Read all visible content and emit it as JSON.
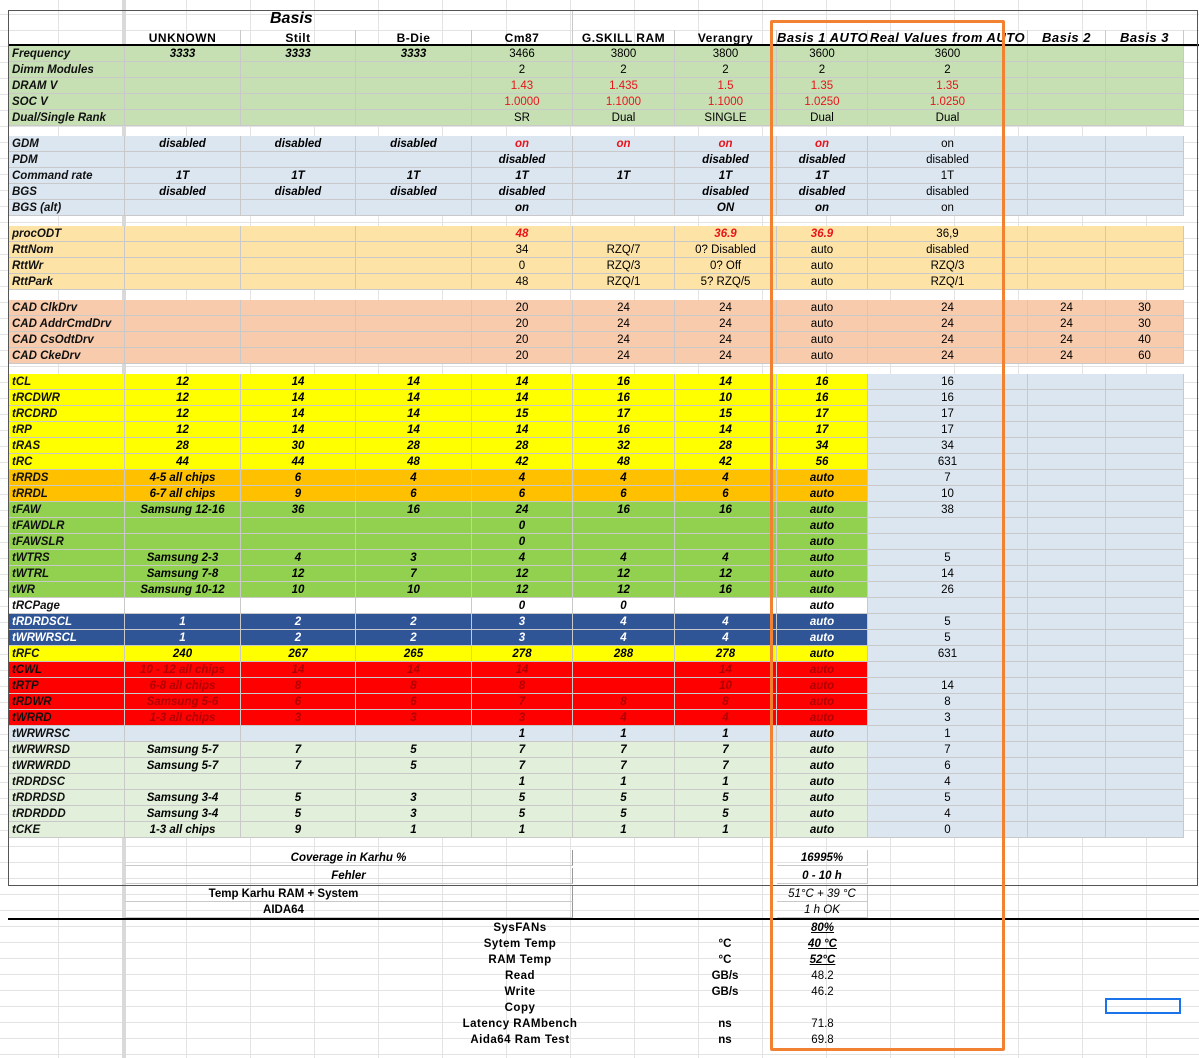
{
  "header": {
    "title": "Basis",
    "columns": [
      "UNKNOWN",
      "Stilt",
      "B-Die",
      "Cm87",
      "G.SKILL RAM",
      "Verangry",
      "Basis 1 AUTO",
      "Real Values from AUTO",
      "Basis 2",
      "Basis 3"
    ]
  },
  "sections": [
    {
      "name": "basic",
      "rows": [
        {
          "label": "Frequency",
          "cells": [
            "3333",
            "3333",
            "3333",
            "3466",
            "3800",
            "3800",
            "3600",
            "3600",
            "",
            ""
          ]
        },
        {
          "label": "Dimm Modules",
          "cells": [
            "",
            "",
            "",
            "2",
            "2",
            "2",
            "2",
            "2",
            "",
            ""
          ]
        },
        {
          "label": "DRAM  V",
          "cells": [
            "",
            "",
            "",
            "1.43",
            "1.435",
            "1.5",
            "1.35",
            "1.35",
            "",
            ""
          ]
        },
        {
          "label": "SOC V",
          "cells": [
            "",
            "",
            "",
            "1.0000",
            "1.1000",
            "1.1000",
            "1.0250",
            "1.0250",
            "",
            ""
          ]
        },
        {
          "label": "Dual/Single Rank",
          "cells": [
            "",
            "",
            "",
            "SR",
            "Dual",
            "SINGLE",
            "Dual",
            "Dual",
            "",
            ""
          ]
        }
      ]
    },
    {
      "name": "gdm",
      "rows": [
        {
          "label": "GDM",
          "cells": [
            "disabled",
            "disabled",
            "disabled",
            "on",
            "on",
            "on",
            "on",
            "on",
            "",
            ""
          ]
        },
        {
          "label": "PDM",
          "cells": [
            "",
            "",
            "",
            "disabled",
            "",
            "disabled",
            "disabled",
            "disabled",
            "",
            ""
          ]
        },
        {
          "label": "Command rate",
          "cells": [
            "1T",
            "1T",
            "1T",
            "1T",
            "1T",
            "1T",
            "1T",
            "1T",
            "",
            ""
          ]
        },
        {
          "label": "BGS",
          "cells": [
            "disabled",
            "disabled",
            "disabled",
            "disabled",
            "",
            "disabled",
            "disabled",
            "disabled",
            "",
            ""
          ]
        },
        {
          "label": "BGS (alt)",
          "cells": [
            "",
            "",
            "",
            "on",
            "",
            "ON",
            "on",
            "on",
            "",
            ""
          ]
        }
      ]
    },
    {
      "name": "odt",
      "rows": [
        {
          "label": "procODT",
          "cells": [
            "",
            "",
            "",
            "48",
            "",
            "36.9",
            "36.9",
            "36,9",
            "",
            ""
          ]
        },
        {
          "label": "RttNom",
          "cells": [
            "",
            "",
            "",
            "34",
            "RZQ/7",
            "0? Disabled",
            "auto",
            "disabled",
            "",
            ""
          ]
        },
        {
          "label": "RttWr",
          "cells": [
            "",
            "",
            "",
            "0",
            "RZQ/3",
            "0? Off",
            "auto",
            "RZQ/3",
            "",
            ""
          ]
        },
        {
          "label": "RttPark",
          "cells": [
            "",
            "",
            "",
            "48",
            "RZQ/1",
            "5?  RZQ/5",
            "auto",
            "RZQ/1",
            "",
            ""
          ]
        }
      ]
    },
    {
      "name": "cad",
      "rows": [
        {
          "label": "CAD ClkDrv",
          "cells": [
            "",
            "",
            "",
            "20",
            "24",
            "24",
            "auto",
            "24",
            "24",
            "30"
          ]
        },
        {
          "label": "CAD AddrCmdDrv",
          "cells": [
            "",
            "",
            "",
            "20",
            "24",
            "24",
            "auto",
            "24",
            "24",
            "30"
          ]
        },
        {
          "label": "CAD CsOdtDrv",
          "cells": [
            "",
            "",
            "",
            "20",
            "24",
            "24",
            "auto",
            "24",
            "24",
            "40"
          ]
        },
        {
          "label": "CAD CkeDrv",
          "cells": [
            "",
            "",
            "",
            "20",
            "24",
            "24",
            "auto",
            "24",
            "24",
            "60"
          ]
        }
      ]
    },
    {
      "name": "timings",
      "rows": [
        {
          "label": "tCL",
          "cells": [
            "12",
            "14",
            "14",
            "14",
            "16",
            "14",
            "16",
            "16",
            "",
            ""
          ]
        },
        {
          "label": "tRCDWR",
          "cells": [
            "12",
            "14",
            "14",
            "14",
            "16",
            "10",
            "16",
            "16",
            "",
            ""
          ]
        },
        {
          "label": "tRCDRD",
          "cells": [
            "12",
            "14",
            "14",
            "15",
            "17",
            "15",
            "17",
            "17",
            "",
            ""
          ]
        },
        {
          "label": "tRP",
          "cells": [
            "12",
            "14",
            "14",
            "14",
            "16",
            "14",
            "17",
            "17",
            "",
            ""
          ]
        },
        {
          "label": "tRAS",
          "cells": [
            "28",
            "30",
            "28",
            "28",
            "32",
            "28",
            "34",
            "34",
            "",
            ""
          ]
        },
        {
          "label": "tRC",
          "cells": [
            "44",
            "44",
            "48",
            "42",
            "48",
            "42",
            "56",
            "631",
            "",
            ""
          ]
        },
        {
          "label": "tRRDS",
          "cells": [
            "4-5 all chips",
            "6",
            "4",
            "4",
            "4",
            "4",
            "auto",
            "7",
            "",
            ""
          ]
        },
        {
          "label": "tRRDL",
          "cells": [
            "6-7 all chips",
            "9",
            "6",
            "6",
            "6",
            "6",
            "auto",
            "10",
            "",
            ""
          ]
        },
        {
          "label": "tFAW",
          "cells": [
            "Samsung 12-16",
            "36",
            "16",
            "24",
            "16",
            "16",
            "auto",
            "38",
            "",
            ""
          ]
        },
        {
          "label": "tFAWDLR",
          "cells": [
            "",
            "",
            "",
            "0",
            "",
            "",
            "auto",
            "",
            "",
            ""
          ]
        },
        {
          "label": "tFAWSLR",
          "cells": [
            "",
            "",
            "",
            "0",
            "",
            "",
            "auto",
            "",
            "",
            ""
          ]
        },
        {
          "label": "tWTRS",
          "cells": [
            "Samsung 2-3",
            "4",
            "3",
            "4",
            "4",
            "4",
            "auto",
            "5",
            "",
            ""
          ]
        },
        {
          "label": "tWTRL",
          "cells": [
            "Samsung 7-8",
            "12",
            "7",
            "12",
            "12",
            "12",
            "auto",
            "14",
            "",
            ""
          ]
        },
        {
          "label": "tWR",
          "cells": [
            "Samsung 10-12",
            "10",
            "10",
            "12",
            "12",
            "16",
            "auto",
            "26",
            "",
            ""
          ]
        },
        {
          "label": "tRCPage",
          "cells": [
            "",
            "",
            "",
            "0",
            "0",
            "",
            "auto",
            "",
            "",
            ""
          ]
        },
        {
          "label": "tRDRDSCL",
          "cells": [
            "1",
            "2",
            "2",
            "3",
            "4",
            "4",
            "auto",
            "5",
            "",
            ""
          ]
        },
        {
          "label": "tWRWRSCL",
          "cells": [
            "1",
            "2",
            "2",
            "3",
            "4",
            "4",
            "auto",
            "5",
            "",
            ""
          ]
        },
        {
          "label": "tRFC",
          "cells": [
            "240",
            "267",
            "265",
            "278",
            "288",
            "278",
            "auto",
            "631",
            "",
            ""
          ]
        },
        {
          "label": "tCWL",
          "cells": [
            "10 - 12 all chips",
            "14",
            "14",
            "14",
            "",
            "14",
            "auto",
            "",
            "",
            ""
          ]
        },
        {
          "label": "tRTP",
          "cells": [
            "6-8 all chips",
            "8",
            "8",
            "8",
            "",
            "10",
            "auto",
            "14",
            "",
            ""
          ]
        },
        {
          "label": "tRDWR",
          "cells": [
            "Samsung 5-6",
            "6",
            "6",
            "7",
            "8",
            "8",
            "auto",
            "8",
            "",
            ""
          ]
        },
        {
          "label": "tWRRD",
          "cells": [
            "1-3 all chips",
            "3",
            "3",
            "3",
            "4",
            "4",
            "auto",
            "3",
            "",
            ""
          ]
        },
        {
          "label": "tWRWRSC",
          "cells": [
            "",
            "",
            "",
            "1",
            "1",
            "1",
            "auto",
            "1",
            "",
            ""
          ]
        },
        {
          "label": "tWRWRSD",
          "cells": [
            "Samsung 5-7",
            "7",
            "5",
            "7",
            "7",
            "7",
            "auto",
            "7",
            "",
            ""
          ]
        },
        {
          "label": "tWRWRDD",
          "cells": [
            "Samsung 5-7",
            "7",
            "5",
            "7",
            "7",
            "7",
            "auto",
            "6",
            "",
            ""
          ]
        },
        {
          "label": "tRDRDSC",
          "cells": [
            "",
            "",
            "",
            "1",
            "1",
            "1",
            "auto",
            "4",
            "",
            ""
          ]
        },
        {
          "label": "tRDRDSD",
          "cells": [
            "Samsung 3-4",
            "5",
            "3",
            "5",
            "5",
            "5",
            "auto",
            "5",
            "",
            ""
          ]
        },
        {
          "label": "tRDRDDD",
          "cells": [
            "Samsung 3-4",
            "5",
            "3",
            "5",
            "5",
            "5",
            "auto",
            "4",
            "",
            ""
          ]
        },
        {
          "label": "tCKE",
          "cells": [
            "1-3 all chips",
            "9",
            "1",
            "1",
            "1",
            "1",
            "auto",
            "0",
            "",
            ""
          ]
        }
      ]
    }
  ],
  "summary": {
    "coverage_label": "Coverage in Karhu %",
    "coverage_value": "16995%",
    "fehler_label": "Fehler",
    "fehler_value": "0 - 10 h",
    "temp_label": "Temp Karhu RAM + System",
    "temp_value": "51°C + 39 °C",
    "aida_label": "AIDA64",
    "aida_value": "1 h OK"
  },
  "bench": [
    {
      "label": "SysFANs",
      "unit": "",
      "value": "80%"
    },
    {
      "label": "Sytem Temp",
      "unit": "°C",
      "value": "40 °C"
    },
    {
      "label": "RAM Temp",
      "unit": "°C",
      "value": "52°C"
    },
    {
      "label": "Read",
      "unit": "GB/s",
      "value": "48.2"
    },
    {
      "label": "Write",
      "unit": "GB/s",
      "value": "46.2"
    },
    {
      "label": "Copy",
      "unit": "",
      "value": ""
    },
    {
      "label": "Latency RAMbench",
      "unit": "ns",
      "value": "71.8"
    },
    {
      "label": "Aida64 Ram Test",
      "unit": "ns",
      "value": "69.8"
    }
  ],
  "colors": {
    "frame": "#f28232",
    "green": "#c6e0b4",
    "blue": "#dce6f1",
    "orange": "#fde3a6",
    "salmon": "#f8cbad",
    "yellow": "#ffff00",
    "amber": "#ffc000",
    "lime": "#92d050",
    "navy": "#2f5597",
    "red": "#ff0000",
    "text_red": "#e8141b"
  }
}
